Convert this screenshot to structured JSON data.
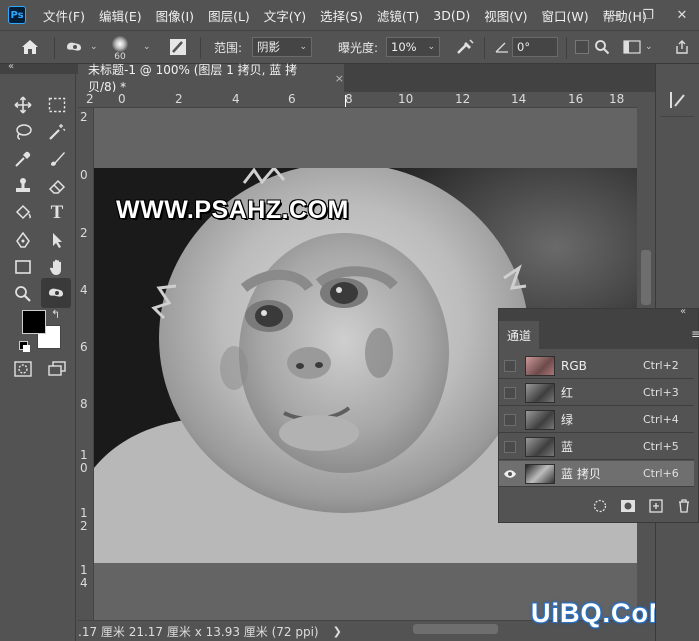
{
  "app": {
    "logo": "Ps"
  },
  "menu": [
    "文件(F)",
    "编辑(E)",
    "图像(I)",
    "图层(L)",
    "文字(Y)",
    "选择(S)",
    "滤镜(T)",
    "3D(D)",
    "视图(V)",
    "窗口(W)",
    "帮助(H)"
  ],
  "window_controls": {
    "minimize": "—",
    "restore": "❐",
    "close": "✕"
  },
  "options": {
    "brush_size": "60",
    "range_label": "范围:",
    "range_value": "阴影",
    "exposure_label": "曝光度:",
    "exposure_value": "10%",
    "angle_value": "0°"
  },
  "document": {
    "tab_title": "未标题-1 @ 100% (图层 1 拷贝, 蓝 拷贝/8) *",
    "close": "×"
  },
  "ruler_h": [
    "2",
    "0",
    "2",
    "4",
    "6",
    "8",
    "10",
    "12",
    "14",
    "16",
    "18"
  ],
  "ruler_v": [
    "2",
    "0",
    "2",
    "4",
    "6",
    "8",
    "1\n0",
    "1\n2",
    "1\n4"
  ],
  "canvas": {
    "watermark": "WWW.PSAHZ.COM"
  },
  "status": {
    "text": ".17 厘米   21.17 厘米 x 13.93 厘米 (72 ppi)",
    "arrow": "❯"
  },
  "brand": "UiBQ.CoM",
  "channels_panel": {
    "tab": "通道",
    "menu_icon": "≡",
    "rows": [
      {
        "name": "RGB",
        "shortcut": "Ctrl+2",
        "visible": false,
        "selected": false
      },
      {
        "name": "红",
        "shortcut": "Ctrl+3",
        "visible": false,
        "selected": false
      },
      {
        "name": "绿",
        "shortcut": "Ctrl+4",
        "visible": false,
        "selected": false
      },
      {
        "name": "蓝",
        "shortcut": "Ctrl+5",
        "visible": false,
        "selected": false
      },
      {
        "name": "蓝 拷贝",
        "shortcut": "Ctrl+6",
        "visible": true,
        "selected": true
      }
    ]
  },
  "collapse_arrows": "«"
}
